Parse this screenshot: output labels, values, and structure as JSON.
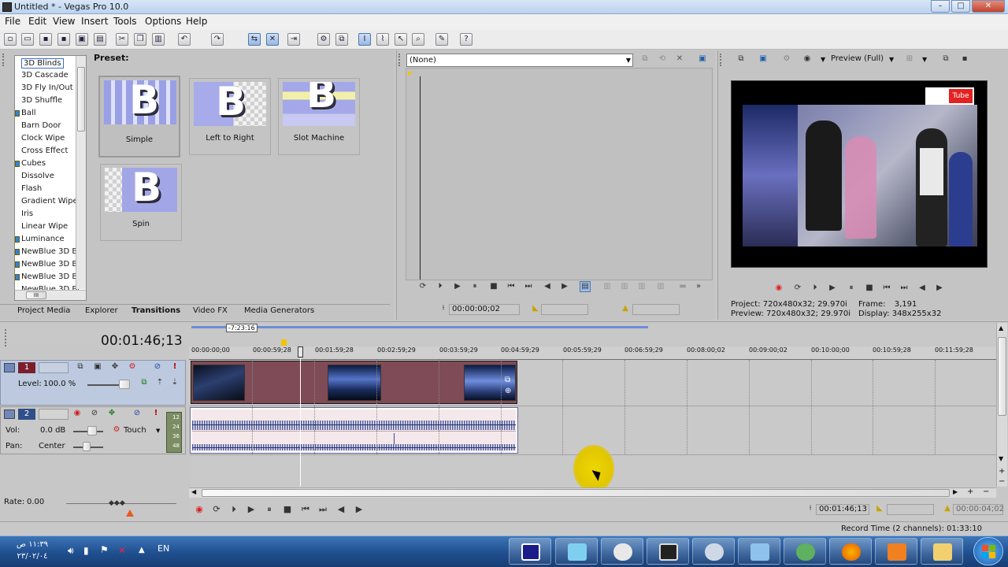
{
  "window": {
    "title": "Untitled * - Vegas Pro 10.0",
    "controls": {
      "minimize": "–",
      "maximize": "□",
      "close": "✕"
    }
  },
  "menu": [
    "File",
    "Edit",
    "View",
    "Insert",
    "Tools",
    "Options",
    "Help"
  ],
  "transitions_panel": {
    "preset_label": "Preset:",
    "list": [
      "3D Blinds",
      "3D Cascade",
      "3D Fly In/Out",
      "3D Shuffle",
      "Ball",
      "Barn Door",
      "Clock Wipe",
      "Cross Effect",
      "Cubes",
      "Dissolve",
      "Flash",
      "Gradient Wipe",
      "Iris",
      "Linear Wipe",
      "Luminance",
      "NewBlue 3D Bl",
      "NewBlue 3D Bo",
      "NewBlue 3D Bo",
      "NewBlue 3D Br"
    ],
    "selected": "3D Blinds",
    "presets": [
      {
        "label": "Simple"
      },
      {
        "label": "Left to Right"
      },
      {
        "label": "Slot Machine"
      },
      {
        "label": "Spin"
      }
    ],
    "scroll_label": "III",
    "tabs": [
      "Project Media",
      "Explorer",
      "Transitions",
      "Video FX",
      "Media Generators"
    ],
    "active_tab": "Transitions"
  },
  "trimmer": {
    "dropdown": "(None)",
    "timecode": "00:00:00;02"
  },
  "preview": {
    "quality": "Preview (Full)",
    "logo_text": "Tube",
    "project_label": "Project:",
    "project": "720x480x32; 29.970i",
    "preview_label": "Preview:",
    "preview": "720x480x32; 29.970i",
    "frame_label": "Frame:",
    "frame": "3,191",
    "display_label": "Display:",
    "display": "348x255x32"
  },
  "timeline": {
    "time": "00:01:46;13",
    "loop_badge": "-7:23:16",
    "ruler": [
      "00:00:00;00",
      "00:00:59;28",
      "00:01:59;28",
      "00:02:59;29",
      "00:03:59;29",
      "00:04:59;29",
      "00:05:59;29",
      "00:06:59;29",
      "00:08:00;02",
      "00:09:00;02",
      "00:10:00;00",
      "00:10:59;28",
      "00:11:59;28"
    ],
    "video_track": {
      "number": "1",
      "level_label": "Level:",
      "level": "100.0 %"
    },
    "audio_track": {
      "number": "2",
      "vol_label": "Vol:",
      "vol": "0.0 dB",
      "pan_label": "Pan:",
      "pan": "Center",
      "mode": "Touch",
      "meter": [
        "12",
        "24",
        "36",
        "48"
      ]
    },
    "rate_label": "Rate:",
    "rate": "0.00",
    "cursor_time": "00:01:46;13",
    "end_time": "00:00:04;02",
    "record_time": "Record Time (2 channels): 01:33:10"
  },
  "taskbar": {
    "clock_time": "١١:٣٩ ص",
    "clock_date": "٢٣/٠٢/٠٤",
    "lang": "EN"
  },
  "colors": {
    "video_clip": "#7f4b56",
    "audio_clip": "#f5e8ea",
    "video_track_header": "#bcc9de",
    "taskbar": "#1f4f8f"
  }
}
